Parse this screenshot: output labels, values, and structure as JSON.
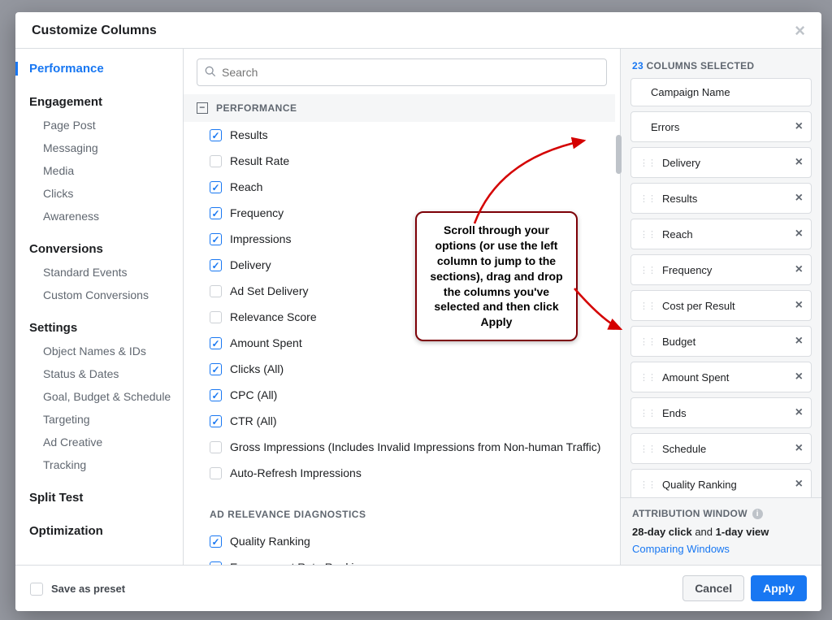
{
  "header": {
    "title": "Customize Columns"
  },
  "sidebar": {
    "top": "Performance",
    "groups": [
      {
        "head": "Engagement",
        "items": [
          "Page Post",
          "Messaging",
          "Media",
          "Clicks",
          "Awareness"
        ]
      },
      {
        "head": "Conversions",
        "items": [
          "Standard Events",
          "Custom Conversions"
        ]
      },
      {
        "head": "Settings",
        "items": [
          "Object Names & IDs",
          "Status & Dates",
          "Goal, Budget & Schedule",
          "Targeting",
          "Ad Creative",
          "Tracking"
        ]
      },
      {
        "head": "Split Test",
        "items": []
      },
      {
        "head": "Optimization",
        "items": []
      }
    ]
  },
  "search": {
    "placeholder": "Search"
  },
  "sections": [
    {
      "title": "PERFORMANCE",
      "options": [
        {
          "label": "Results",
          "checked": true
        },
        {
          "label": "Result Rate",
          "checked": false
        },
        {
          "label": "Reach",
          "checked": true
        },
        {
          "label": "Frequency",
          "checked": true
        },
        {
          "label": "Impressions",
          "checked": true
        },
        {
          "label": "Delivery",
          "checked": true
        },
        {
          "label": "Ad Set Delivery",
          "checked": false
        },
        {
          "label": "Relevance Score",
          "checked": false
        },
        {
          "label": "Amount Spent",
          "checked": true
        },
        {
          "label": "Clicks (All)",
          "checked": true
        },
        {
          "label": "CPC (All)",
          "checked": true
        },
        {
          "label": "CTR (All)",
          "checked": true
        },
        {
          "label": "Gross Impressions (Includes Invalid Impressions from Non-human Traffic)",
          "checked": false
        },
        {
          "label": "Auto-Refresh Impressions",
          "checked": false
        }
      ]
    },
    {
      "title": "AD RELEVANCE DIAGNOSTICS",
      "options": [
        {
          "label": "Quality Ranking",
          "checked": true
        },
        {
          "label": "Engagement Rate Ranking",
          "checked": true
        }
      ]
    }
  ],
  "selected": {
    "count": "23",
    "countLabel": "COLUMNS SELECTED",
    "items": [
      {
        "label": "Campaign Name",
        "draggable": false,
        "removable": false
      },
      {
        "label": "Errors",
        "draggable": false,
        "removable": true
      },
      {
        "label": "Delivery",
        "draggable": true,
        "removable": true
      },
      {
        "label": "Results",
        "draggable": true,
        "removable": true
      },
      {
        "label": "Reach",
        "draggable": true,
        "removable": true
      },
      {
        "label": "Frequency",
        "draggable": true,
        "removable": true
      },
      {
        "label": "Cost per Result",
        "draggable": true,
        "removable": true
      },
      {
        "label": "Budget",
        "draggable": true,
        "removable": true
      },
      {
        "label": "Amount Spent",
        "draggable": true,
        "removable": true
      },
      {
        "label": "Ends",
        "draggable": true,
        "removable": true
      },
      {
        "label": "Schedule",
        "draggable": true,
        "removable": true
      },
      {
        "label": "Quality Ranking",
        "draggable": true,
        "removable": true
      }
    ]
  },
  "attribution": {
    "heading": "ATTRIBUTION WINDOW",
    "line_1a": "28-day click",
    "line_1b": " and ",
    "line_1c": "1-day view",
    "link": "Comparing Windows"
  },
  "footer": {
    "preset": "Save as preset",
    "cancel": "Cancel",
    "apply": "Apply"
  },
  "tip": "Scroll through your options (or use the left column to jump to the sections), drag and drop the columns you've selected and then click Apply"
}
